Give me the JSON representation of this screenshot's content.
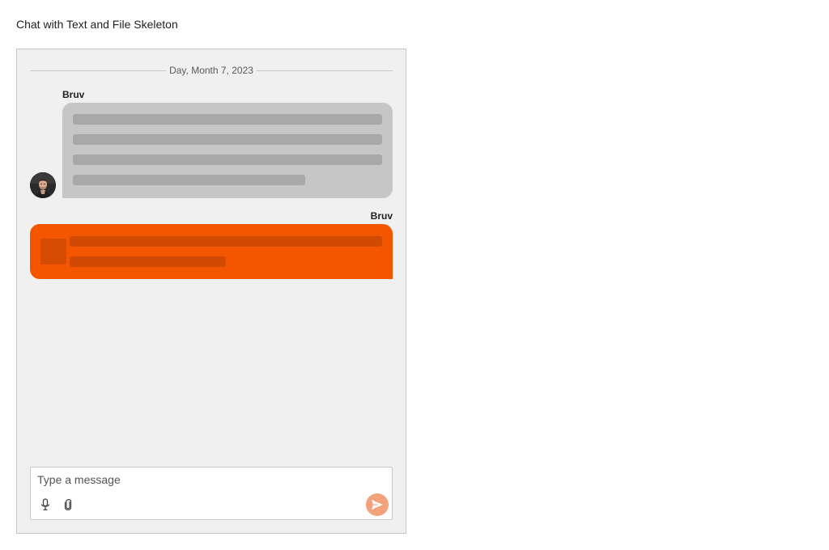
{
  "page": {
    "title": "Chat with Text and File Skeleton"
  },
  "chat": {
    "date_separator": "Day, Month 7, 2023",
    "messages": [
      {
        "author": "Bruv",
        "direction": "incoming",
        "kind": "text-skeleton",
        "avatar": "user-avatar-photo"
      },
      {
        "author": "Bruv",
        "direction": "outgoing",
        "kind": "file-skeleton"
      }
    ]
  },
  "composer": {
    "placeholder": "Type a message",
    "value": "",
    "icons": {
      "mic": "microphone-icon",
      "attach": "paperclip-icon",
      "send": "send-icon"
    }
  },
  "colors": {
    "incoming_bubble": "#c6c6c6",
    "incoming_skeleton": "#a8a8a8",
    "outgoing_bubble": "#f45600",
    "outgoing_skeleton": "#d14a04",
    "send_button": "#f3a37b",
    "frame_background": "#f0f0f0"
  }
}
